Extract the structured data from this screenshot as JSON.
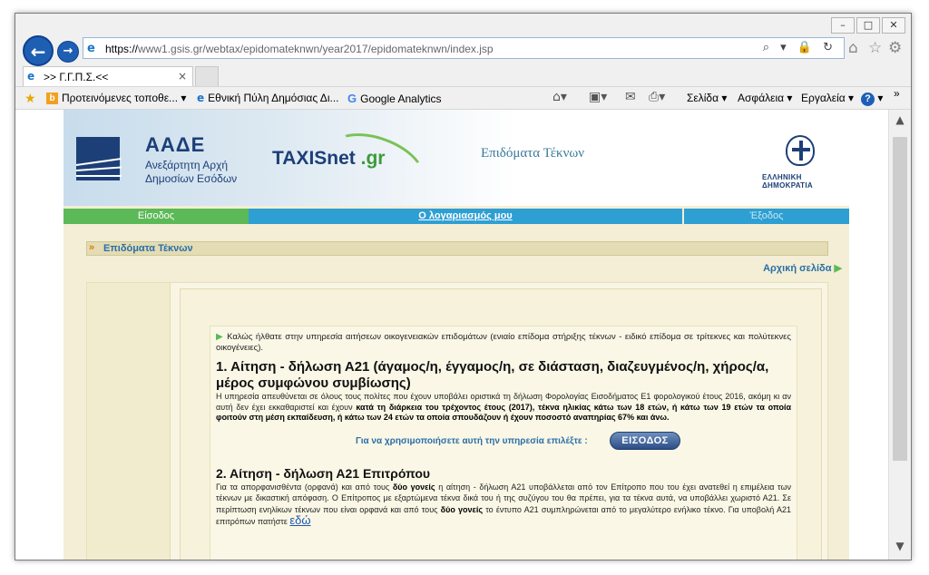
{
  "browser": {
    "window_controls": [
      "–",
      "□",
      "✕"
    ],
    "address": {
      "scheme": "https://",
      "host": "www1.gsis.gr",
      "path": "/webtax/epidomateknwn/year2017/epidomateknwn/index.jsp",
      "tools": "⌕ ▾ 🔒 ↻"
    },
    "right_icons": [
      "⌂",
      "☆",
      "⚙"
    ],
    "tab": {
      "title": ">> Γ.Γ.Π.Σ.<<",
      "close": "×"
    },
    "favorites": [
      {
        "label": "Προτεινόμενες τοποθε... ▾"
      },
      {
        "label": "Εθνική Πύλη Δημόσιας Δι..."
      },
      {
        "label": "Google Analytics"
      }
    ],
    "commands": {
      "page": "Σελίδα ▾",
      "safety": "Ασφάλεια ▾",
      "tools": "Εργαλεία ▾",
      "more": "»"
    }
  },
  "site": {
    "org_name": "ΑΑΔΕ",
    "org_sub_1": "Ανεξάρτητη Αρχή",
    "org_sub_2": "Δημοσίων Εσόδων",
    "taxis_1": "TAXISnet",
    "taxis_2": ".gr",
    "service_title": "Επιδόματα Τέκνων",
    "emblem_text": "ΕΛΛΗΝΙΚΗ ΔΗΜΟΚΡΑΤΙΑ",
    "menu": {
      "login": "Είσοδος",
      "account": "Ο λογαριασμός μου",
      "logout": "Έξοδος"
    },
    "section_title": "Επιδόματα Τέκνων",
    "home_link": "Αρχική σελίδα",
    "welcome": "Καλώς ήλθατε στην υπηρεσία αιτήσεων οικογενειακών επιδομάτων (ενιαίο επίδομα στήριξης τέκνων - ειδικό επίδομα σε τρίτεκνες και πολύτεκνες οικογένειες).",
    "s1_title": "1. Αίτηση - δήλωση Α21 (άγαμος/η, έγγαμος/η, σε διάσταση, διαζευγμένος/η, χήρος/α, μέρος συμφώνου συμβίωσης)",
    "s1_text_a": "Η υπηρεσία απευθύνεται σε όλους τους πολίτες που έχουν υποβάλει οριστικά τη δήλωση Φορολογίας Εισοδήματος Ε1 φορολογικού έτους 2016, ακόμη κι αν αυτή δεν έχει εκκαθαριστεί και έχουν ",
    "s1_text_b": "κατά τη διάρκεια του τρέχοντος έτους (2017), τέκνα ηλικίας κάτω των 18 ετών, ή κάτω των 19 ετών τα οποία φοιτούν στη μέση εκπαίδευση, ή κάτω των 24 ετών τα οποία σπουδάζουν ή έχουν ποσοστό αναπηρίας 67% και άνω.",
    "cta_question": "Για να χρησιμοποιήσετε αυτή την υπηρεσία επιλέξτε :",
    "cta_button": "ΕΙΣΟΔΟΣ",
    "s2_title": "2. Αίτηση - δήλωση Α21 Επιτρόπου",
    "s2_text_a": "Για τα απορφανισθέντα (ορφανά) και από τους ",
    "s2_text_b": "δύο γονείς",
    "s2_text_c": " η αίτηση - δήλωση Α21 υποβάλλεται από τον Επίτροπο που του έχει ανατεθεί η επιμέλεια των τέκνων με δικαστική απόφαση. Ο Επίτροπος με εξαρτώμενα τέκνα δικά του ή της συζύγου του θα πρέπει, για τα τέκνα αυτά, να υποβάλλει χωριστό Α21. Σε περίπτωση ενηλίκων τέκνων που είναι ορφανά και από τους ",
    "s2_text_d": "δύο γονείς",
    "s2_text_e": " το έντυπο Α21 συμπληρώνεται από το μεγαλύτερο ενήλικο τέκνο. Για υποβολή Α21 επιτρόπων πατήστε ",
    "s2_here": "εδώ"
  }
}
